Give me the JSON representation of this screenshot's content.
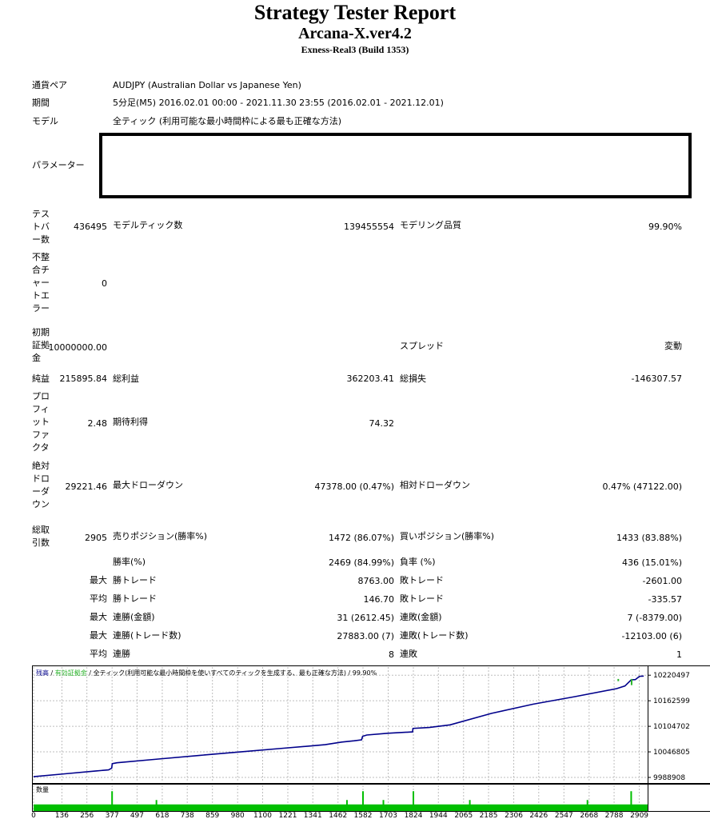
{
  "title": "Strategy Tester Report",
  "ea_name": "Arcana-X.ver4.2",
  "server": "Exness-Real3 (Build 1353)",
  "info": {
    "symbol_label": "通貨ペア",
    "symbol_value": "AUDJPY (Australian Dollar vs Japanese Yen)",
    "period_label": "期間",
    "period_value": "5分足(M5) 2016.02.01 00:00 - 2021.11.30 23:55 (2016.02.01 - 2021.12.01)",
    "model_label": "モデル",
    "model_value": "全ティック (利用可能な最小時間枠による最も正確な方法)",
    "params_label": "パラメーター"
  },
  "stats": {
    "bars_label": "テストバー数",
    "bars_value": "436495",
    "ticks_label": "モデルティック数",
    "ticks_value": "139455554",
    "quality_label": "モデリング品質",
    "quality_value": "99.90%",
    "mismatch_label": "不整合チャートエラー",
    "mismatch_value": "0",
    "deposit_label": "初期証拠金",
    "deposit_value": "10000000.00",
    "spread_label": "スプレッド",
    "spread_value": "変動",
    "net_label": "純益",
    "net_value": "215895.84",
    "gross_profit_label": "総利益",
    "gross_profit_value": "362203.41",
    "gross_loss_label": "総損失",
    "gross_loss_value": "-146307.57",
    "pf_label": "プロフィットファクタ",
    "pf_value": "2.48",
    "expected_label": "期待利得",
    "expected_value": "74.32",
    "abs_dd_label": "絶対ドローダウン",
    "abs_dd_value": "29221.46",
    "max_dd_label": "最大ドローダウン",
    "max_dd_value": "47378.00 (0.47%)",
    "rel_dd_label": "相対ドローダウン",
    "rel_dd_value": "0.47% (47122.00)",
    "trades_label": "総取引数",
    "trades_value": "2905",
    "short_label": "売りポジション(勝率%)",
    "short_value": "1472 (86.07%)",
    "long_label": "買いポジション(勝率%)",
    "long_value": "1433 (83.88%)",
    "win_label": "勝率(%)",
    "win_value": "2469 (84.99%)",
    "loss_label": "負率 (%)",
    "loss_value": "436 (15.01%)",
    "largest": "最大",
    "average": "平均",
    "largest_win_label": "勝トレード",
    "largest_win_value": "8763.00",
    "largest_loss_label": "敗トレード",
    "largest_loss_value": "-2601.00",
    "avg_win_label": "勝トレード",
    "avg_win_value": "146.70",
    "avg_loss_label": "敗トレード",
    "avg_loss_value": "-335.57",
    "max_cons_wins_label": "連勝(金額)",
    "max_cons_wins_value": "31 (2612.45)",
    "max_cons_losses_label": "連敗(金額)",
    "max_cons_losses_value": "7 (-8379.00)",
    "max_cons_profit_label": "連勝(トレード数)",
    "max_cons_profit_value": "27883.00 (7)",
    "max_cons_loss_label": "連敗(トレード数)",
    "max_cons_loss_value": "-12103.00 (6)",
    "avg_cons_wins_label": "連勝",
    "avg_cons_wins_value": "8",
    "avg_cons_losses_label": "連敗",
    "avg_cons_losses_value": "1"
  },
  "chart_data": {
    "type": "line",
    "legend_balance": "残高",
    "legend_equity": "有効証拠金",
    "legend_rest": "全ティック(利用可能な最小時間枠を使いすべてのティックを生成する、最も正確な方法) / 99.90%",
    "volume_label": "数量",
    "y_ticks": [
      "10220497",
      "10162599",
      "10104702",
      "10046805",
      "9988908"
    ],
    "y_tick_values": [
      10220497,
      10162599,
      10104702,
      10046805,
      9988908
    ],
    "ylim": [
      9988908,
      10239000
    ],
    "x_ticks": [
      "0",
      "136",
      "256",
      "377",
      "497",
      "618",
      "738",
      "859",
      "980",
      "1100",
      "1221",
      "1341",
      "1462",
      "1582",
      "1703",
      "1824",
      "1944",
      "2065",
      "2185",
      "2306",
      "2426",
      "2547",
      "2668",
      "2788",
      "2909"
    ],
    "x_tick_values": [
      0,
      136,
      256,
      377,
      497,
      618,
      738,
      859,
      980,
      1100,
      1221,
      1341,
      1462,
      1582,
      1703,
      1824,
      1944,
      2065,
      2185,
      2306,
      2426,
      2547,
      2668,
      2788,
      2909
    ],
    "xlim": [
      0,
      2949
    ],
    "balance": {
      "x": [
        0,
        150,
        300,
        360,
        375,
        378,
        400,
        600,
        800,
        1000,
        1200,
        1400,
        1480,
        1540,
        1575,
        1580,
        1600,
        1700,
        1820,
        1822,
        1900,
        2000,
        2200,
        2400,
        2600,
        2800,
        2840,
        2870,
        2890,
        2910,
        2930
      ],
      "y": [
        9990500,
        9997000,
        10003500,
        10006000,
        10010000,
        10020000,
        10022000,
        10030500,
        10039000,
        10047000,
        10055000,
        10063000,
        10069000,
        10072000,
        10074000,
        10082000,
        10085000,
        10089000,
        10092000,
        10100000,
        10102000,
        10108000,
        10134000,
        10155000,
        10172000,
        10190000,
        10196000,
        10210000,
        10210500,
        10218000,
        10218500
      ]
    },
    "equity_dips": [
      {
        "x": 2808,
        "y": 10207000
      },
      {
        "x": 2872,
        "y": 10198000
      }
    ],
    "volume_spikes": [
      {
        "x": 377,
        "v": 4.5
      },
      {
        "x": 590,
        "v": 2.5
      },
      {
        "x": 1505,
        "v": 2.5
      },
      {
        "x": 1582,
        "v": 4.5
      },
      {
        "x": 1680,
        "v": 2.5
      },
      {
        "x": 1824,
        "v": 4.5
      },
      {
        "x": 2095,
        "v": 2.5
      },
      {
        "x": 2660,
        "v": 2.5
      },
      {
        "x": 2870,
        "v": 4.5
      }
    ],
    "colors": {
      "balance": "#00008b",
      "equity": "#2cb42c",
      "volume": "#00bf00",
      "grid": "#bdbdbd"
    }
  }
}
